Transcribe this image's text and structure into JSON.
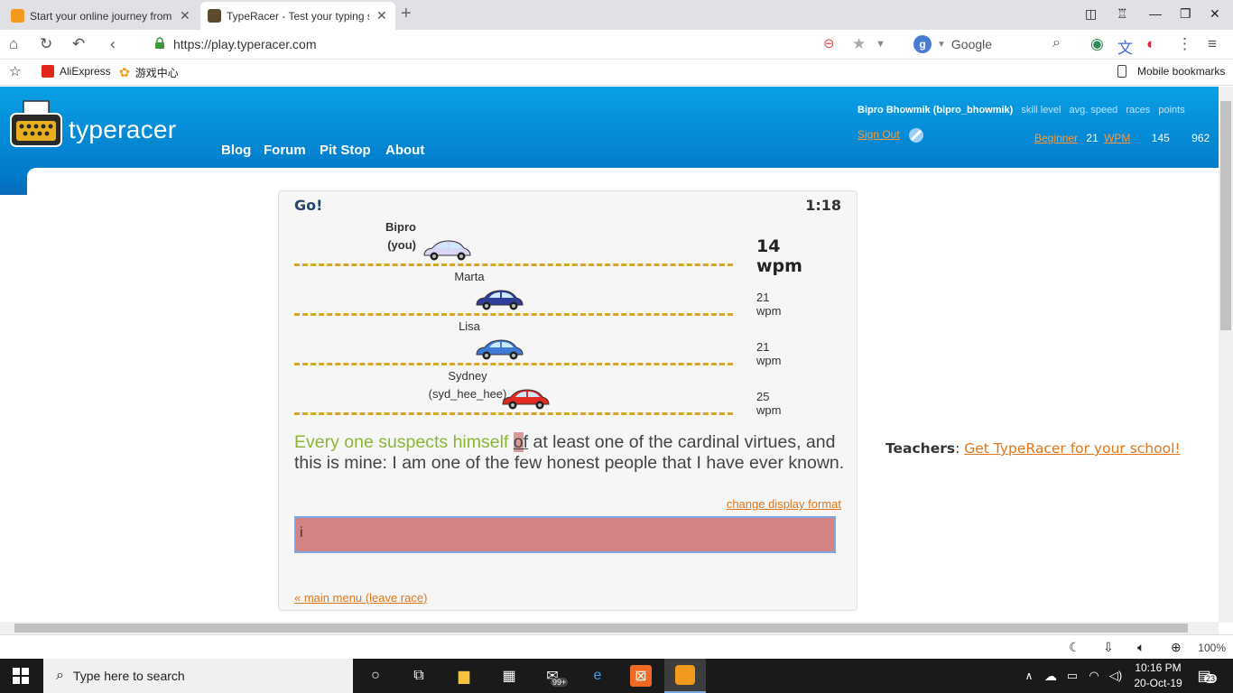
{
  "browser": {
    "tabs": [
      {
        "title": "Start your online journey from",
        "active": false,
        "close": "✕"
      },
      {
        "title": "TypeRacer - Test your typing sp",
        "active": true,
        "close": "✕"
      }
    ],
    "new_tab": "+",
    "url": "https://play.typeracer.com",
    "search_engine": "Google",
    "bookmarks": [
      "AliExpress",
      "游戏中心"
    ],
    "mobile_bookmarks": "Mobile bookmarks",
    "zoom": "100%"
  },
  "site": {
    "logo": "typeracer",
    "nav": [
      "Blog",
      "Forum",
      "Pit Stop",
      "About"
    ],
    "user": {
      "name": "Bipro Bhowmik (bipro_bhowmik)",
      "col_headers": [
        "skill level",
        "avg. speed",
        "races",
        "points"
      ],
      "sign_out": "Sign Out",
      "skill": "Beginner",
      "speed_value": "21",
      "speed_unit": "WPM",
      "races": "145",
      "points": "962"
    }
  },
  "race": {
    "status": "Go!",
    "timer": "1:18",
    "racers": [
      {
        "name_line1": "Bipro",
        "name_line2": "(you)",
        "wpm": "14 wpm",
        "progress": 0.29,
        "car_color": "#d8d8f4",
        "you": true
      },
      {
        "name_line1": "Marta",
        "name_line2": "",
        "wpm": "21 wpm",
        "progress": 0.41,
        "car_color": "#2d3f9a",
        "you": false
      },
      {
        "name_line1": "Lisa",
        "name_line2": "",
        "wpm": "21 wpm",
        "progress": 0.41,
        "car_color": "#3f7ad6",
        "you": false
      },
      {
        "name_line1": "Sydney",
        "name_line2": "(syd_hee_hee)",
        "wpm": "25 wpm",
        "progress": 0.47,
        "car_color": "#e22a20",
        "you": false
      }
    ],
    "passage_typed": "Every one suspects himself ",
    "passage_current": "o",
    "passage_current_rest": "f",
    "passage_rest": " at least one of the cardinal virtues, and this is mine: I am one of the few honest people that I have ever known.",
    "change_format": "change display format",
    "input_value": "i",
    "main_menu": "« main menu (leave race)"
  },
  "teachers": {
    "label": "Teachers",
    "link": "Get TypeRacer for your school!"
  },
  "taskbar": {
    "search_placeholder": "Type here to search",
    "time": "10:16 PM",
    "date": "20-Oct-19",
    "mail_badge": "99+",
    "notif_count": "23"
  }
}
